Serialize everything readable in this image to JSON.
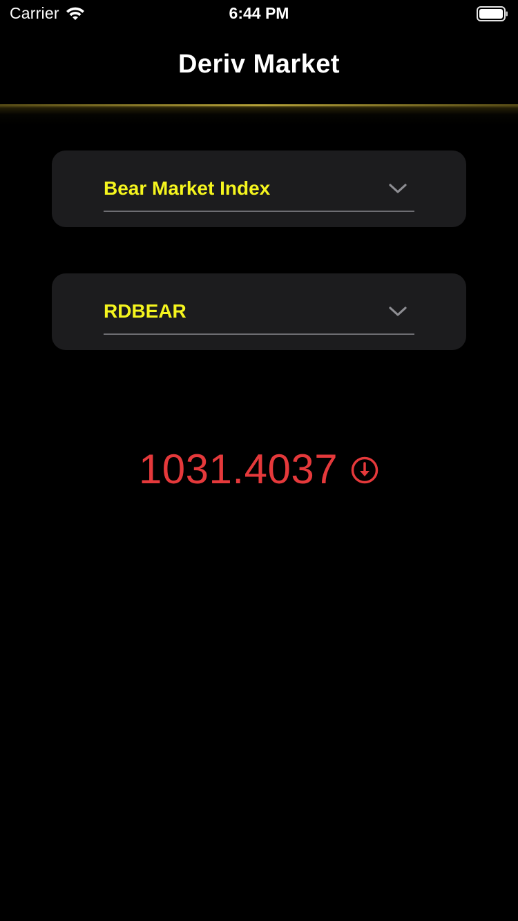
{
  "status_bar": {
    "carrier": "Carrier",
    "time": "6:44 PM",
    "wifi_icon": "wifi-icon",
    "battery_icon": "battery-icon"
  },
  "nav": {
    "title": "Deriv Market"
  },
  "market_picker": {
    "selected_value": "Bear Market Index",
    "icon": "chevron-down-icon"
  },
  "symbol_picker": {
    "selected_value": "RDBEAR",
    "icon": "chevron-down-icon"
  },
  "price": {
    "value": "1031.4037",
    "direction_icon": "arrow-down-circle-icon"
  },
  "colors": {
    "background": "#000000",
    "card": "#1c1c1e",
    "accent_yellow": "#f5f51e",
    "price_down_red": "#e5393b",
    "divider": "#6d6d72"
  }
}
